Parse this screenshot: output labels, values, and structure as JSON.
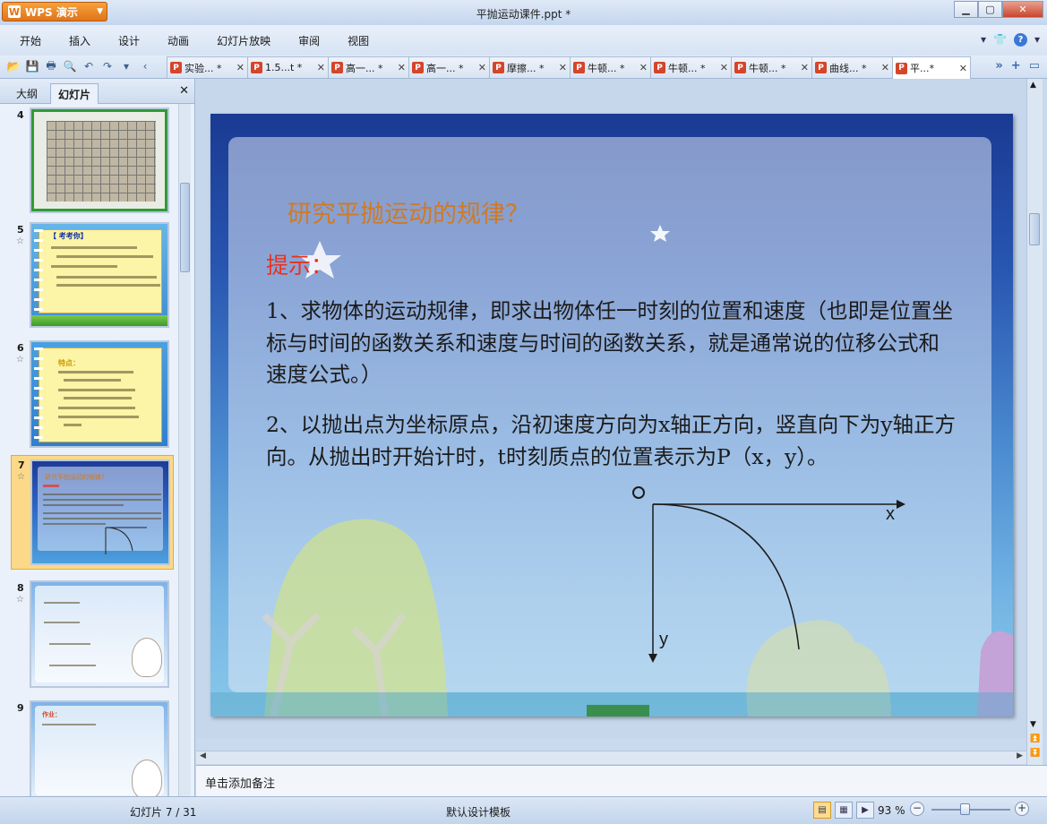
{
  "app": {
    "name": "WPS 演示",
    "window_title": "平抛运动课件.ppt *"
  },
  "menu": [
    "开始",
    "插入",
    "设计",
    "动画",
    "幻灯片放映",
    "审阅",
    "视图"
  ],
  "doc_tabs": [
    {
      "label": "实验... *"
    },
    {
      "label": "1.5...t *"
    },
    {
      "label": "高一... *"
    },
    {
      "label": "高一... *"
    },
    {
      "label": "摩擦... *"
    },
    {
      "label": "牛顿... *"
    },
    {
      "label": "牛顿... *"
    },
    {
      "label": "牛顿... *"
    },
    {
      "label": "曲线... *"
    },
    {
      "label": "平...*"
    }
  ],
  "panel": {
    "tabs": [
      "大纲",
      "幻灯片"
    ],
    "active_tab": "幻灯片"
  },
  "thumbnails": [
    {
      "number": "4",
      "star": ""
    },
    {
      "number": "5",
      "star": "☆",
      "heading": "【 考考你】"
    },
    {
      "number": "6",
      "star": "☆",
      "heading": "特点："
    },
    {
      "number": "7",
      "star": "☆",
      "heading": "研究平抛运动的规律？"
    },
    {
      "number": "8",
      "star": "☆"
    },
    {
      "number": "9",
      "star": "",
      "heading": "作业："
    }
  ],
  "slide": {
    "title": "研究平抛运动的规律？",
    "hint": "提示：",
    "para1": "1、求物体的运动规律，即求出物体任一时刻的位置和速度（也即是位置坐标与时间的函数关系和速度与时间的函数关系，就是通常说的位移公式和速度公式。）",
    "para2": "2、以抛出点为坐标原点，沿初速度方向为x轴正方向，竖直向下为y轴正方向。从抛出时开始计时，t时刻质点的位置表示为P（x，y）。",
    "origin_label": "O",
    "x_label": "x",
    "y_label": "y"
  },
  "notes_placeholder": "单击添加备注",
  "status": {
    "slide_position": "幻灯片 7 / 31",
    "template": "默认设计模板",
    "zoom": "93 %"
  },
  "colors": {
    "title_orange": "#d07a24",
    "hint_red": "#e8331d",
    "wps_orange": "#e0741a"
  }
}
